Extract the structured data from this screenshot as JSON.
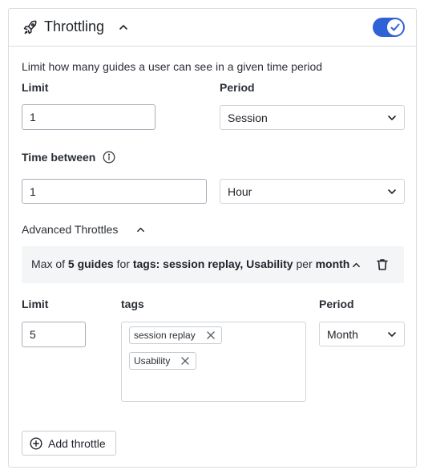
{
  "header": {
    "title": "Throttling",
    "toggle_on": true
  },
  "description": "Limit how many guides a user can see in a given time period",
  "limit": {
    "label": "Limit",
    "value": "1"
  },
  "period": {
    "label": "Period",
    "value": "Session"
  },
  "time_between": {
    "label": "Time between",
    "value": "1",
    "unit": "Hour"
  },
  "advanced": {
    "label": "Advanced Throttles",
    "rule": {
      "prefix": "Max of",
      "count": "5 guides",
      "for_word": "for",
      "tags_phrase": "tags: session replay, Usability",
      "per_word": "per",
      "period": "month"
    },
    "limit_label": "Limit",
    "limit_value": "5",
    "tags_label": "tags",
    "tags": [
      "session replay",
      "Usability"
    ],
    "period_label": "Period",
    "period_value": "Month"
  },
  "add_button": "Add throttle",
  "colors": {
    "accent": "#2f62d6",
    "border": "#d9dce1",
    "panel_bg": "#f4f5f7"
  }
}
